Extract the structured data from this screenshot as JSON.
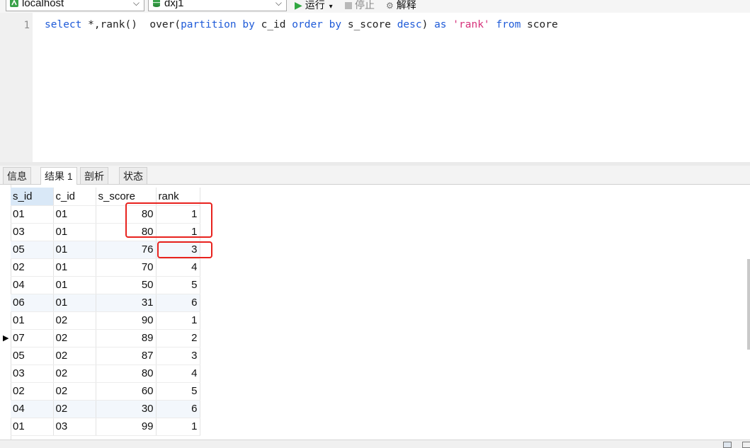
{
  "toolbar": {
    "connection": "localhost",
    "database": "dxj1",
    "run_label": "运行",
    "stop_label": "停止",
    "explain_label": "解释",
    "dropdown_arrow": "▾"
  },
  "editor": {
    "line_number": "1",
    "sql": {
      "t1": "select",
      "t2": " *,rank()  over(",
      "t3": "partition",
      "t4": " ",
      "t5": "by",
      "t6": " c_id ",
      "t7": "order",
      "t8": " ",
      "t9": "by",
      "t10": " s_score ",
      "t11": "desc",
      "t12": ") ",
      "t13": "as",
      "t14": " ",
      "t15": "'rank'",
      "t16": " ",
      "t17": "from",
      "t18": " score"
    }
  },
  "tabs": [
    {
      "label": "信息"
    },
    {
      "label": "结果 1"
    },
    {
      "label": "剖析"
    },
    {
      "label": "状态"
    }
  ],
  "grid": {
    "headers": [
      "s_id",
      "c_id",
      "s_score",
      "rank"
    ],
    "rows": [
      [
        "01",
        "01",
        "80",
        "1"
      ],
      [
        "03",
        "01",
        "80",
        "1"
      ],
      [
        "05",
        "01",
        "76",
        "3"
      ],
      [
        "02",
        "01",
        "70",
        "4"
      ],
      [
        "04",
        "01",
        "50",
        "5"
      ],
      [
        "06",
        "01",
        "31",
        "6"
      ],
      [
        "01",
        "02",
        "90",
        "1"
      ],
      [
        "07",
        "02",
        "89",
        "2"
      ],
      [
        "05",
        "02",
        "87",
        "3"
      ],
      [
        "03",
        "02",
        "80",
        "4"
      ],
      [
        "02",
        "02",
        "60",
        "5"
      ],
      [
        "04",
        "02",
        "30",
        "6"
      ],
      [
        "01",
        "03",
        "99",
        "1"
      ]
    ],
    "current_row_marker": "▶"
  },
  "colors": {
    "keyword": "#1f5bd8",
    "string": "#d6317a",
    "highlight": "#e8221e",
    "selected_header": "#d9e8f7"
  }
}
